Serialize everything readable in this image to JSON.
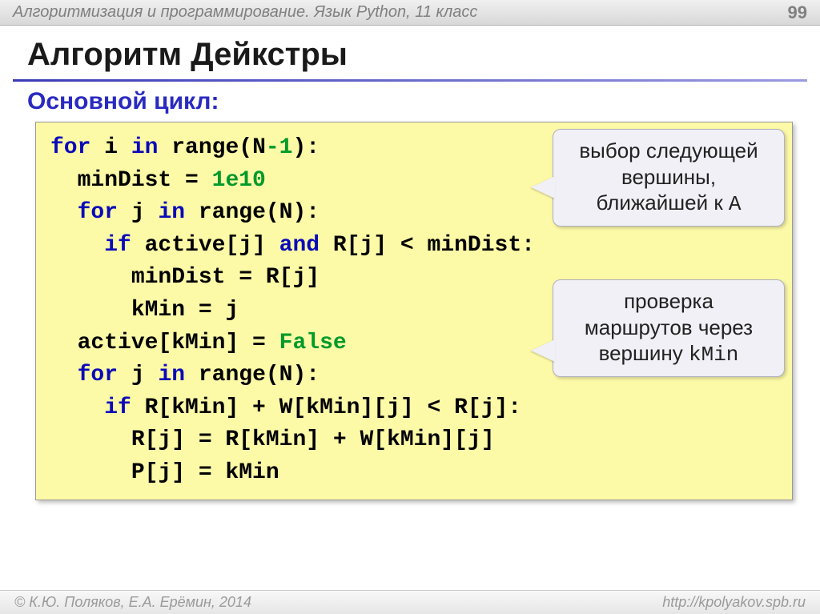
{
  "header": {
    "course": "Алгоритмизация и программирование. Язык Python, 11 класс",
    "page": "99"
  },
  "title": "Алгоритм Дейкстры",
  "subtitle": "Основной цикл:",
  "code": {
    "l1": {
      "kw1": "for",
      "t1": " i ",
      "kw2": "in",
      "t2": " range(N",
      "num": "-1",
      "t3": "):"
    },
    "l2": {
      "pad": "  minDist = ",
      "num": "1e10"
    },
    "l3": {
      "pad": "  ",
      "kw1": "for",
      "t1": " j ",
      "kw2": "in",
      "t2": " range(N):"
    },
    "l4": {
      "pad": "    ",
      "kw1": "if",
      "t1": " active[j] ",
      "kw2": "and",
      "t2": " R[j] < minDist:"
    },
    "l5": "      minDist = R[j]",
    "l6": "      kMin = j",
    "l7": {
      "pad": "  active[kMin] = ",
      "fal": "False"
    },
    "l8": {
      "pad": "  ",
      "kw1": "for",
      "t1": " j ",
      "kw2": "in",
      "t2": " range(N):"
    },
    "l9": {
      "pad": "    ",
      "kw1": "if",
      "t1": " R[kMin] + W[kMin][j] < R[j]:"
    },
    "l10": "      R[j] = R[kMin] + W[kMin][j]",
    "l11": "      P[j] = kMin"
  },
  "callout1": {
    "line1": "выбор следующей",
    "line2": "вершины,",
    "line3a": "ближайшей к ",
    "line3b": "A"
  },
  "callout2": {
    "line1": "проверка",
    "line2": "маршрутов через",
    "line3a": "вершину ",
    "line3b": "kMin"
  },
  "footer": {
    "left": "© К.Ю. Поляков, Е.А. Ерёмин, 2014",
    "right": "http://kpolyakov.spb.ru"
  }
}
